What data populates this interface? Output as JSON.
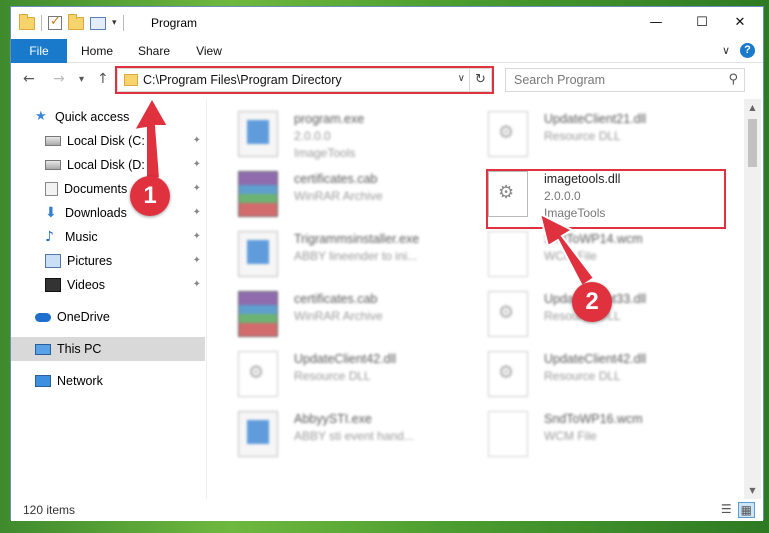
{
  "window": {
    "title": "Program",
    "controls": [
      "—",
      "☐",
      "✕"
    ]
  },
  "ribbon": {
    "tabs": [
      "File",
      "Home",
      "Share",
      "View"
    ],
    "expand": "∨",
    "help": "?"
  },
  "nav": {
    "back": "←",
    "forward": "→",
    "recent": "▾",
    "up": "↑",
    "address": "C:\\Program Files\\Program Directory",
    "address_dropdown": "∨",
    "refresh": "↻",
    "search_placeholder": "Search Program",
    "search_icon": "⚲"
  },
  "sidebar": {
    "items": [
      {
        "label": "Quick access",
        "icon": "star-icon",
        "pinned": false
      },
      {
        "label": "Local Disk (C:)",
        "icon": "disk-icon",
        "pinned": true
      },
      {
        "label": "Local Disk (D:)",
        "icon": "disk-icon",
        "pinned": true
      },
      {
        "label": "Documents",
        "icon": "documents-icon",
        "pinned": true
      },
      {
        "label": "Downloads",
        "icon": "download-icon",
        "pinned": true
      },
      {
        "label": "Music",
        "icon": "music-icon",
        "pinned": true
      },
      {
        "label": "Pictures",
        "icon": "pictures-icon",
        "pinned": true
      },
      {
        "label": "Videos",
        "icon": "videos-icon",
        "pinned": true
      },
      {
        "label": "OneDrive",
        "icon": "cloud-icon",
        "pinned": false
      },
      {
        "label": "This PC",
        "icon": "computer-icon",
        "pinned": false,
        "selected": true
      },
      {
        "label": "Network",
        "icon": "network-icon",
        "pinned": false
      }
    ],
    "pin_glyph": "📌"
  },
  "files": {
    "left": [
      {
        "name": "program.exe",
        "sub1": "2.0.0.0",
        "sub2": "ImageTools",
        "icon": "exe"
      },
      {
        "name": "certificates.cab",
        "sub1": "WinRAR Archive",
        "sub2": "",
        "icon": "rar"
      },
      {
        "name": "Trigrammsinstaller.exe",
        "sub1": "ABBY lineender to ini...",
        "sub2": "",
        "icon": "exe"
      },
      {
        "name": "certificates.cab",
        "sub1": "WinRAR Archive",
        "sub2": "",
        "icon": "rar"
      },
      {
        "name": "UpdateClient42.dll",
        "sub1": "Resource DLL",
        "sub2": "",
        "icon": "dll"
      },
      {
        "name": "AbbyySTI.exe",
        "sub1": "ABBY sti event hand...",
        "sub2": "",
        "icon": "exe"
      }
    ],
    "right": [
      {
        "name": "UpdateClient21.dll",
        "sub1": "Resource DLL",
        "sub2": "",
        "icon": "dll"
      },
      {
        "name": "imagetools.dll",
        "sub1": "2.0.0.0",
        "sub2": "ImageTools",
        "icon": "dll",
        "highlighted": true
      },
      {
        "name": "SndToWP14.wcm",
        "sub1": "WCM File",
        "sub2": "",
        "icon": "wcm"
      },
      {
        "name": "UpdateClient33.dll",
        "sub1": "Resource DLL",
        "sub2": "",
        "icon": "dll"
      },
      {
        "name": "UpdateClient42.dll",
        "sub1": "Resource DLL",
        "sub2": "",
        "icon": "dll"
      },
      {
        "name": "SndToWP16.wcm",
        "sub1": "WCM File",
        "sub2": "",
        "icon": "wcm"
      }
    ]
  },
  "status": {
    "count": "120 items",
    "view_details": "☰",
    "view_tiles": "▦"
  },
  "annotations": {
    "step1": "1",
    "step2": "2",
    "color": "#e0313f"
  },
  "scroll": {
    "up": "▲",
    "down": "▼"
  }
}
